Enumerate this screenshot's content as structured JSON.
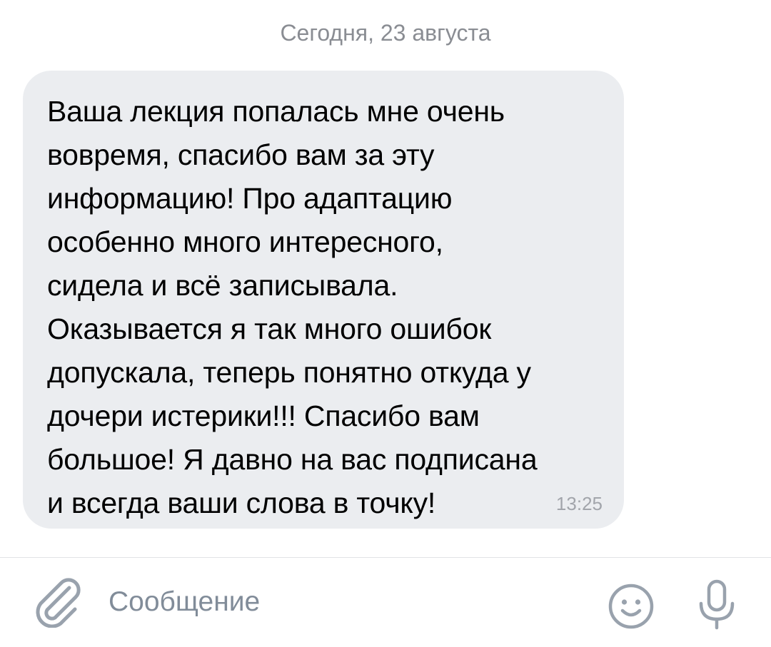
{
  "chat": {
    "date_separator": "Сегодня, 23 августа",
    "message": {
      "lines": [
        "Ваша лекция попалась мне очень",
        "вовремя, спасибо вам за эту",
        "информацию! Про адаптацию",
        "особенно много интересного,",
        "сидела и всё записывала.",
        "Оказывается я так много ошибок",
        "допускала, теперь понятно откуда у",
        "дочери истерики!!! Спасибо вам",
        "большое! Я давно на вас подписана",
        "и всегда ваши слова в точку!"
      ],
      "time": "13:25"
    }
  },
  "composer": {
    "placeholder": "Сообщение",
    "value": "",
    "icons": {
      "attach": "paperclip-icon",
      "emoji": "smiley-icon",
      "mic": "microphone-icon"
    }
  },
  "colors": {
    "bubble_bg": "#ebedf0",
    "secondary_text": "#8a8d93",
    "icon_gray": "#99a2ad",
    "placeholder": "#818c99"
  }
}
